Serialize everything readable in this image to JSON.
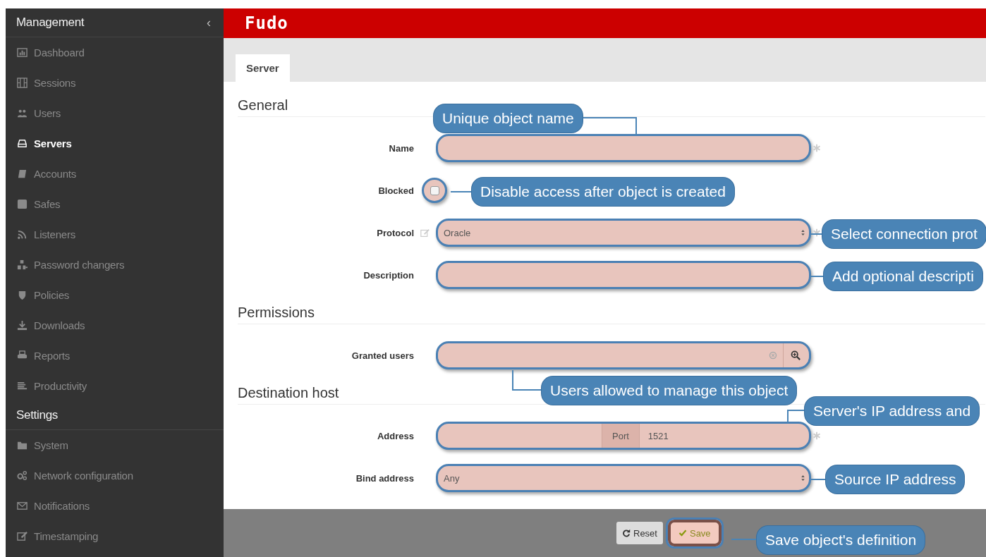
{
  "sidebar": {
    "sections": [
      {
        "title": "Management",
        "collapse_icon": "‹",
        "items": [
          {
            "label": "Dashboard",
            "selected": false
          },
          {
            "label": "Sessions",
            "selected": false
          },
          {
            "label": "Users",
            "selected": false
          },
          {
            "label": "Servers",
            "selected": true
          },
          {
            "label": "Accounts",
            "selected": false
          },
          {
            "label": "Safes",
            "selected": false
          },
          {
            "label": "Listeners",
            "selected": false
          },
          {
            "label": "Password changers",
            "selected": false
          },
          {
            "label": "Policies",
            "selected": false
          },
          {
            "label": "Downloads",
            "selected": false
          },
          {
            "label": "Reports",
            "selected": false
          },
          {
            "label": "Productivity",
            "selected": false
          }
        ]
      },
      {
        "title": "Settings",
        "items": [
          {
            "label": "System",
            "selected": false
          },
          {
            "label": "Network configuration",
            "selected": false
          },
          {
            "label": "Notifications",
            "selected": false
          },
          {
            "label": "Timestamping",
            "selected": false
          }
        ]
      }
    ]
  },
  "header": {
    "logo": "Fudo"
  },
  "tabs": [
    {
      "label": "Server",
      "selected": true
    }
  ],
  "sections": [
    {
      "title": "General",
      "fields": [
        {
          "label": "Name",
          "kind": "text",
          "required": true,
          "highlighted": true
        },
        {
          "label": "Blocked",
          "kind": "checkbox",
          "checked": false,
          "highlighted": true
        },
        {
          "label": "Protocol",
          "kind": "select",
          "value": "Oracle",
          "editable": true,
          "required": true,
          "highlighted": true
        },
        {
          "label": "Description",
          "kind": "text",
          "required": false,
          "highlighted": true
        }
      ]
    },
    {
      "title": "Permissions",
      "fields": [
        {
          "label": "Granted users",
          "kind": "lookup",
          "highlighted": true
        }
      ]
    },
    {
      "title": "Destination host",
      "fields": [
        {
          "label": "Address",
          "kind": "address",
          "port_label": "Port",
          "port_value": "1521",
          "required": true,
          "highlighted": true
        },
        {
          "label": "Bind address",
          "kind": "select",
          "value": "Any",
          "editable": false,
          "required": false,
          "highlighted": true
        }
      ]
    }
  ],
  "buttons": [
    {
      "label": "Reset",
      "kind": "reset",
      "highlighted": false
    },
    {
      "label": "Save",
      "kind": "save",
      "highlighted": true
    }
  ],
  "callouts": [
    {
      "text": "Unique object name"
    },
    {
      "text": "Disable access after object is created"
    },
    {
      "text": "Select connection prot"
    },
    {
      "text": "Add optional descripti"
    },
    {
      "text": "Users allowed to manage this object"
    },
    {
      "text": "Server's IP address and"
    },
    {
      "text": "Source IP address"
    },
    {
      "text": "Save object's definition"
    }
  ]
}
